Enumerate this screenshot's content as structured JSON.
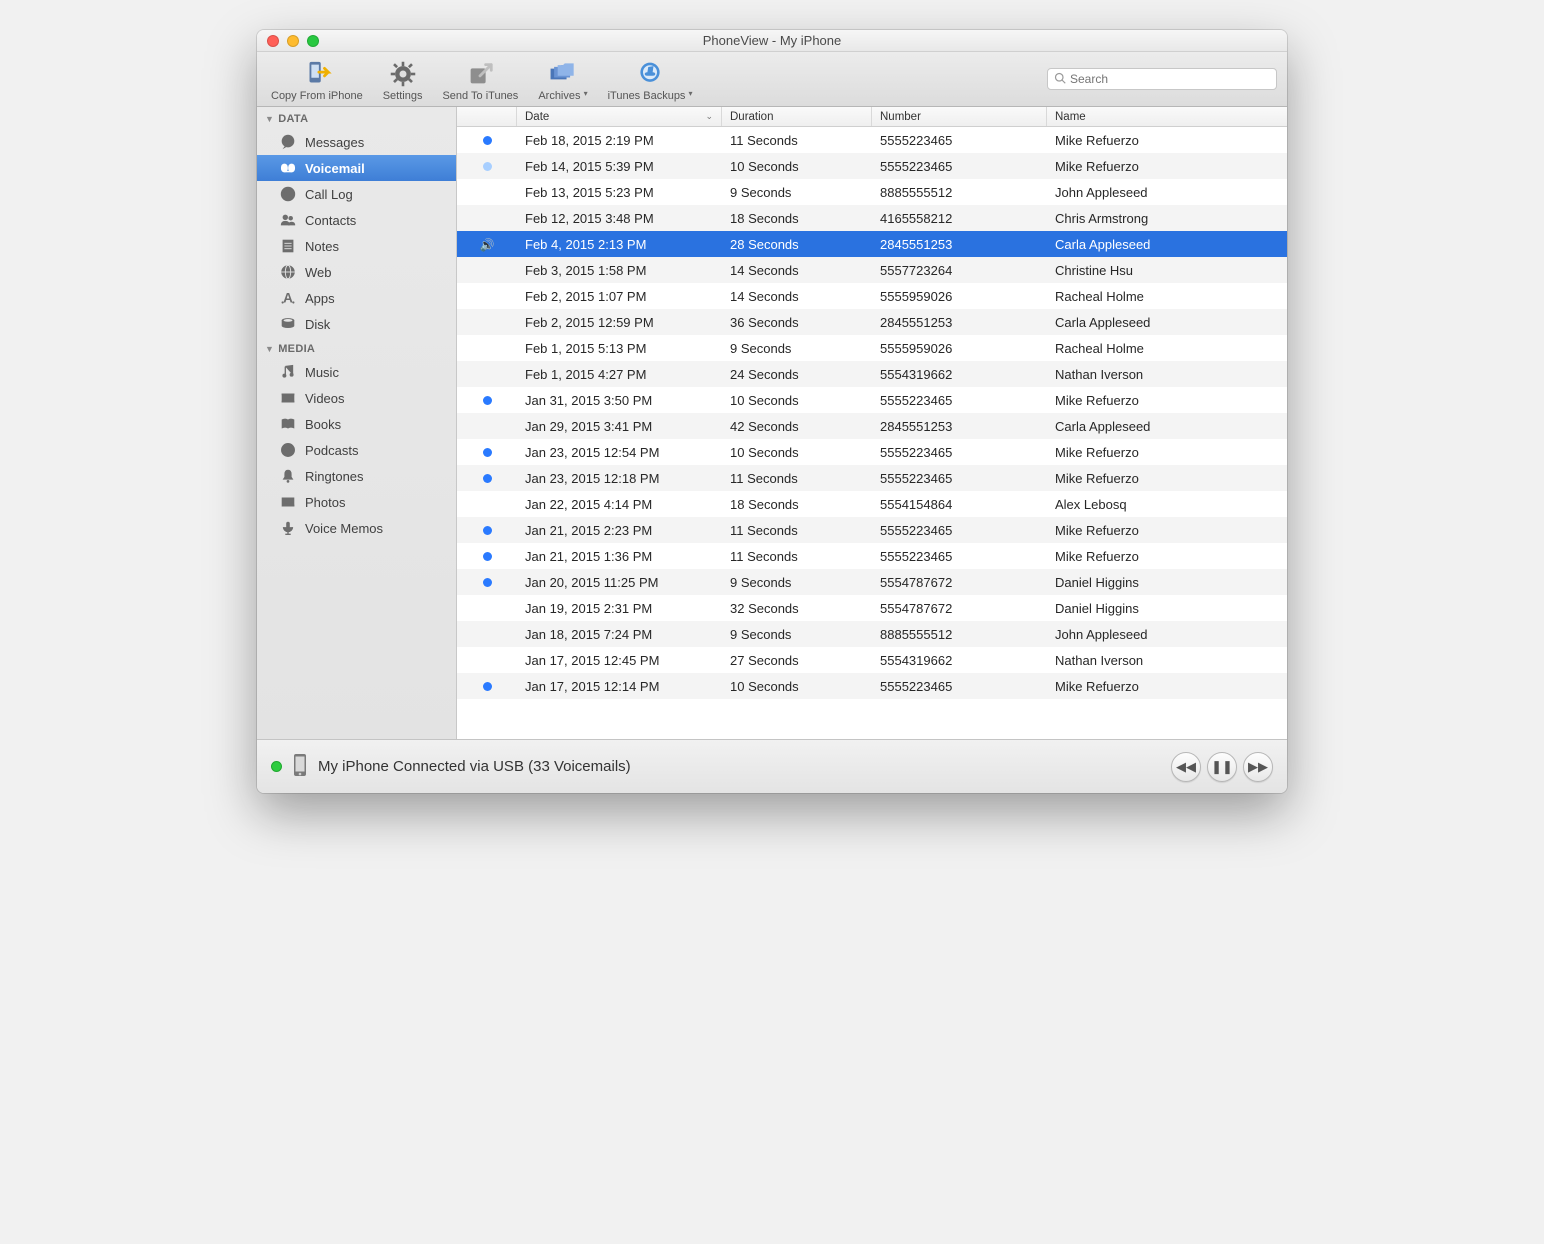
{
  "title": "PhoneView - My iPhone",
  "toolbar": {
    "copy": "Copy From iPhone",
    "settings": "Settings",
    "send": "Send To iTunes",
    "archives": "Archives",
    "backups": "iTunes Backups"
  },
  "search": {
    "placeholder": "Search"
  },
  "sidebar": {
    "groups": [
      {
        "header": "DATA",
        "items": [
          {
            "label": "Messages",
            "icon": "messages"
          },
          {
            "label": "Voicemail",
            "icon": "voicemail",
            "selected": true
          },
          {
            "label": "Call Log",
            "icon": "calllog"
          },
          {
            "label": "Contacts",
            "icon": "contacts"
          },
          {
            "label": "Notes",
            "icon": "notes"
          },
          {
            "label": "Web",
            "icon": "web"
          },
          {
            "label": "Apps",
            "icon": "apps"
          },
          {
            "label": "Disk",
            "icon": "disk"
          }
        ]
      },
      {
        "header": "MEDIA",
        "items": [
          {
            "label": "Music",
            "icon": "music"
          },
          {
            "label": "Videos",
            "icon": "videos"
          },
          {
            "label": "Books",
            "icon": "books"
          },
          {
            "label": "Podcasts",
            "icon": "podcasts"
          },
          {
            "label": "Ringtones",
            "icon": "ringtones"
          },
          {
            "label": "Photos",
            "icon": "photos"
          },
          {
            "label": "Voice Memos",
            "icon": "voicememos"
          }
        ]
      }
    ]
  },
  "columns": [
    "",
    "Date",
    "Duration",
    "Number",
    "Name"
  ],
  "sort_column": 1,
  "rows": [
    {
      "mark": "unread",
      "date": "Feb 18, 2015 2:19 PM",
      "duration": "11 Seconds",
      "number": "5555223465",
      "name": "Mike Refuerzo"
    },
    {
      "mark": "unread-light",
      "date": "Feb 14, 2015 5:39 PM",
      "duration": "10 Seconds",
      "number": "5555223465",
      "name": "Mike Refuerzo"
    },
    {
      "mark": "",
      "date": "Feb 13, 2015 5:23 PM",
      "duration": "9 Seconds",
      "number": "8885555512",
      "name": "John Appleseed"
    },
    {
      "mark": "",
      "date": "Feb 12, 2015 3:48 PM",
      "duration": "18 Seconds",
      "number": "4165558212",
      "name": "Chris Armstrong"
    },
    {
      "mark": "playing",
      "date": "Feb 4, 2015 2:13 PM",
      "duration": "28 Seconds",
      "number": "2845551253",
      "name": "Carla Appleseed",
      "selected": true
    },
    {
      "mark": "",
      "date": "Feb 3, 2015 1:58 PM",
      "duration": "14 Seconds",
      "number": "5557723264",
      "name": "Christine Hsu"
    },
    {
      "mark": "",
      "date": "Feb 2, 2015 1:07 PM",
      "duration": "14 Seconds",
      "number": "5555959026",
      "name": "Racheal Holme"
    },
    {
      "mark": "",
      "date": "Feb 2, 2015 12:59 PM",
      "duration": "36 Seconds",
      "number": "2845551253",
      "name": "Carla Appleseed"
    },
    {
      "mark": "",
      "date": "Feb 1, 2015 5:13 PM",
      "duration": "9 Seconds",
      "number": "5555959026",
      "name": "Racheal Holme"
    },
    {
      "mark": "",
      "date": "Feb 1, 2015 4:27 PM",
      "duration": "24 Seconds",
      "number": "5554319662",
      "name": "Nathan Iverson"
    },
    {
      "mark": "unread",
      "date": "Jan 31, 2015 3:50 PM",
      "duration": "10 Seconds",
      "number": "5555223465",
      "name": "Mike Refuerzo"
    },
    {
      "mark": "",
      "date": "Jan 29, 2015 3:41 PM",
      "duration": "42 Seconds",
      "number": "2845551253",
      "name": "Carla Appleseed"
    },
    {
      "mark": "unread",
      "date": "Jan 23, 2015 12:54 PM",
      "duration": "10 Seconds",
      "number": "5555223465",
      "name": "Mike Refuerzo"
    },
    {
      "mark": "unread",
      "date": "Jan 23, 2015 12:18 PM",
      "duration": "11 Seconds",
      "number": "5555223465",
      "name": "Mike Refuerzo"
    },
    {
      "mark": "",
      "date": "Jan 22, 2015 4:14 PM",
      "duration": "18 Seconds",
      "number": "5554154864",
      "name": "Alex Lebosq"
    },
    {
      "mark": "unread",
      "date": "Jan 21, 2015 2:23 PM",
      "duration": "11 Seconds",
      "number": "5555223465",
      "name": "Mike Refuerzo"
    },
    {
      "mark": "unread",
      "date": "Jan 21, 2015 1:36 PM",
      "duration": "11 Seconds",
      "number": "5555223465",
      "name": "Mike Refuerzo"
    },
    {
      "mark": "unread",
      "date": "Jan 20, 2015 11:25 PM",
      "duration": "9 Seconds",
      "number": "5554787672",
      "name": "Daniel Higgins"
    },
    {
      "mark": "",
      "date": "Jan 19, 2015 2:31 PM",
      "duration": "32 Seconds",
      "number": "5554787672",
      "name": "Daniel Higgins"
    },
    {
      "mark": "",
      "date": "Jan 18, 2015 7:24 PM",
      "duration": "9 Seconds",
      "number": "8885555512",
      "name": "John Appleseed"
    },
    {
      "mark": "",
      "date": "Jan 17, 2015 12:45 PM",
      "duration": "27 Seconds",
      "number": "5554319662",
      "name": "Nathan Iverson"
    },
    {
      "mark": "unread",
      "date": "Jan 17, 2015 12:14 PM",
      "duration": "10 Seconds",
      "number": "5555223465",
      "name": "Mike Refuerzo"
    }
  ],
  "status": "My iPhone Connected via USB (33 Voicemails)"
}
